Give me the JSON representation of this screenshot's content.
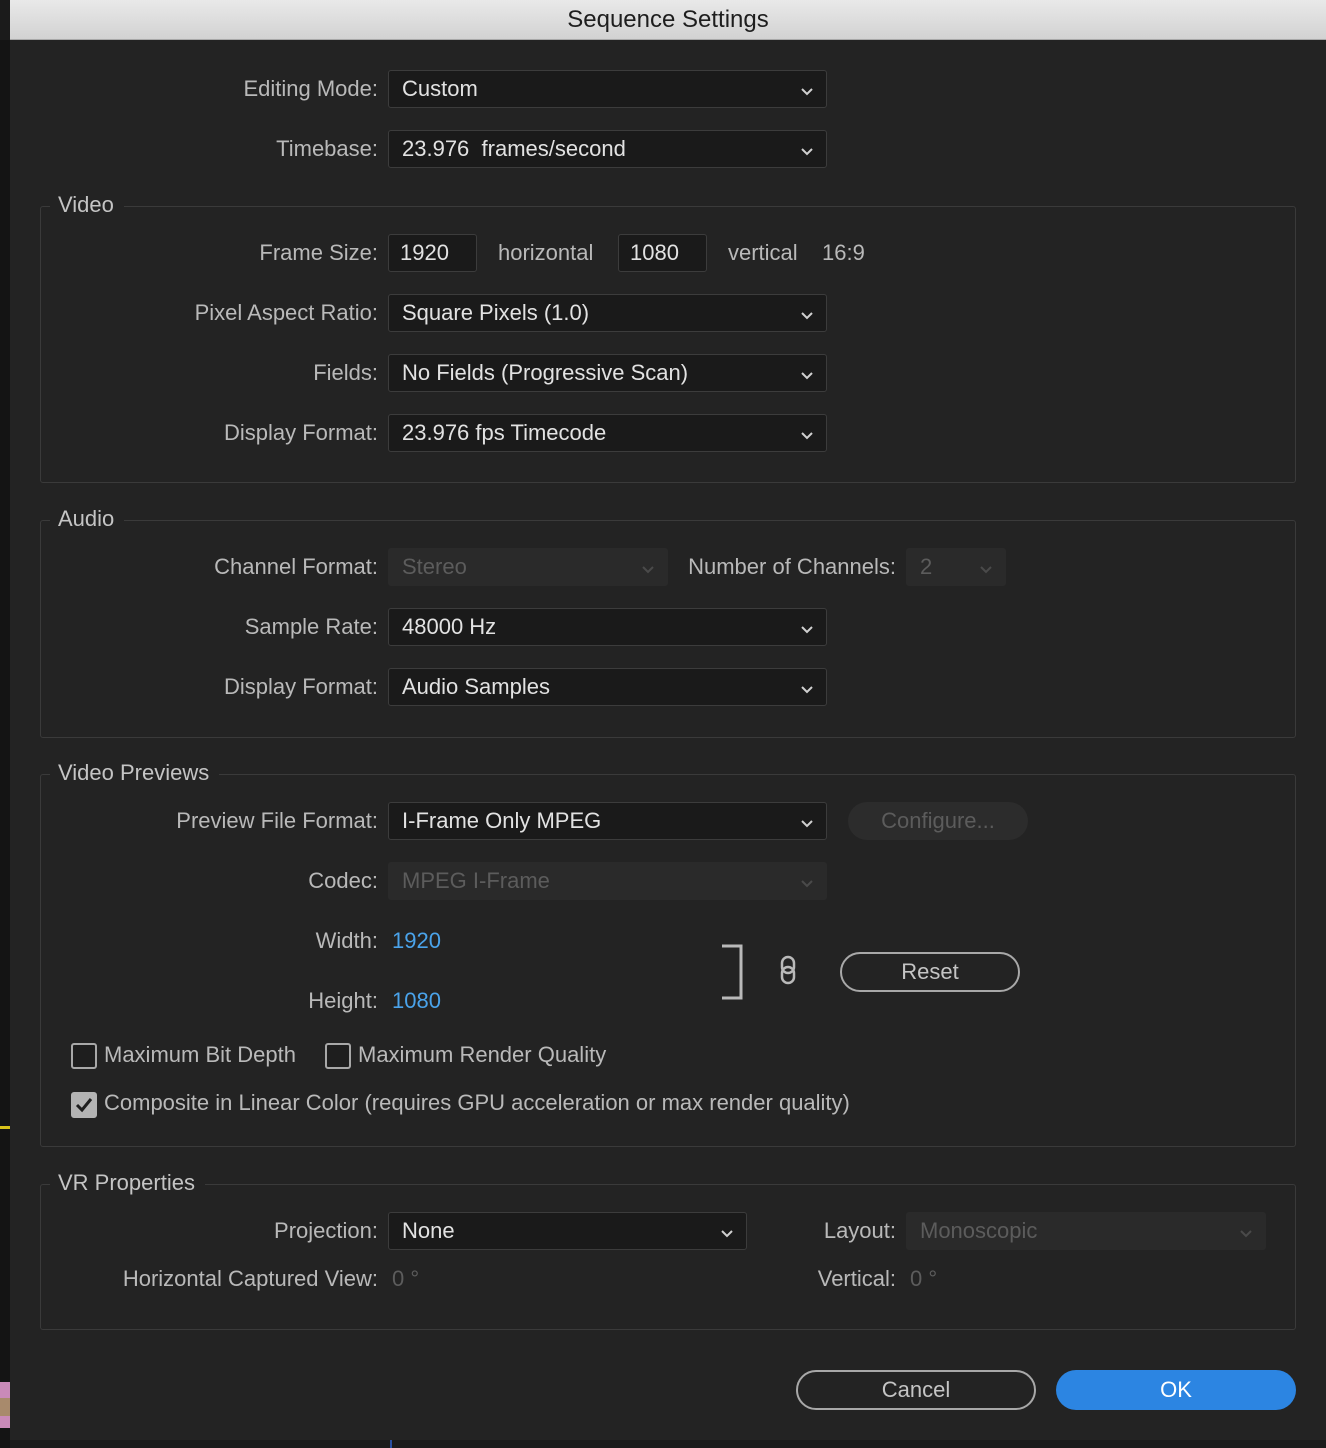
{
  "window": {
    "title": "Sequence Settings"
  },
  "general": {
    "editing_mode": {
      "label": "Editing Mode:",
      "value": "Custom"
    },
    "timebase": {
      "label": "Timebase:",
      "value": "23.976  frames/second"
    }
  },
  "video": {
    "title": "Video",
    "frame_size": {
      "label": "Frame Size:",
      "width": "1920",
      "horizontal_label": "horizontal",
      "height": "1080",
      "vertical_label": "vertical",
      "aspect": "16:9"
    },
    "pixel_aspect_ratio": {
      "label": "Pixel Aspect Ratio:",
      "value": "Square Pixels (1.0)"
    },
    "fields": {
      "label": "Fields:",
      "value": "No Fields (Progressive Scan)"
    },
    "display_format": {
      "label": "Display Format:",
      "value": "23.976 fps Timecode"
    }
  },
  "audio": {
    "title": "Audio",
    "channel_format": {
      "label": "Channel Format:",
      "value": "Stereo",
      "disabled": true
    },
    "number_of_channels": {
      "label": "Number of Channels:",
      "value": "2",
      "disabled": true
    },
    "sample_rate": {
      "label": "Sample Rate:",
      "value": "48000 Hz"
    },
    "display_format": {
      "label": "Display Format:",
      "value": "Audio Samples"
    }
  },
  "video_previews": {
    "title": "Video Previews",
    "preview_file_format": {
      "label": "Preview File Format:",
      "value": "I-Frame Only MPEG"
    },
    "configure_button": "Configure...",
    "codec": {
      "label": "Codec:",
      "value": "MPEG I-Frame",
      "disabled": true
    },
    "width": {
      "label": "Width:",
      "value": "1920"
    },
    "height": {
      "label": "Height:",
      "value": "1080"
    },
    "reset_button": "Reset",
    "max_bit_depth": {
      "label": "Maximum Bit Depth",
      "checked": false
    },
    "max_render_quality": {
      "label": "Maximum Render Quality",
      "checked": false
    },
    "composite_linear": {
      "label": "Composite in Linear Color (requires GPU acceleration or max render quality)",
      "checked": true
    }
  },
  "vr": {
    "title": "VR Properties",
    "projection": {
      "label": "Projection:",
      "value": "None"
    },
    "layout": {
      "label": "Layout:",
      "value": "Monoscopic",
      "disabled": true
    },
    "horizontal_view": {
      "label": "Horizontal Captured View:",
      "value": "0 °"
    },
    "vertical": {
      "label": "Vertical:",
      "value": "0 °"
    }
  },
  "footer": {
    "cancel": "Cancel",
    "ok": "OK"
  },
  "colors": {
    "accent": "#2c85e2",
    "link_value": "#4aa3ea",
    "background": "#232323"
  }
}
